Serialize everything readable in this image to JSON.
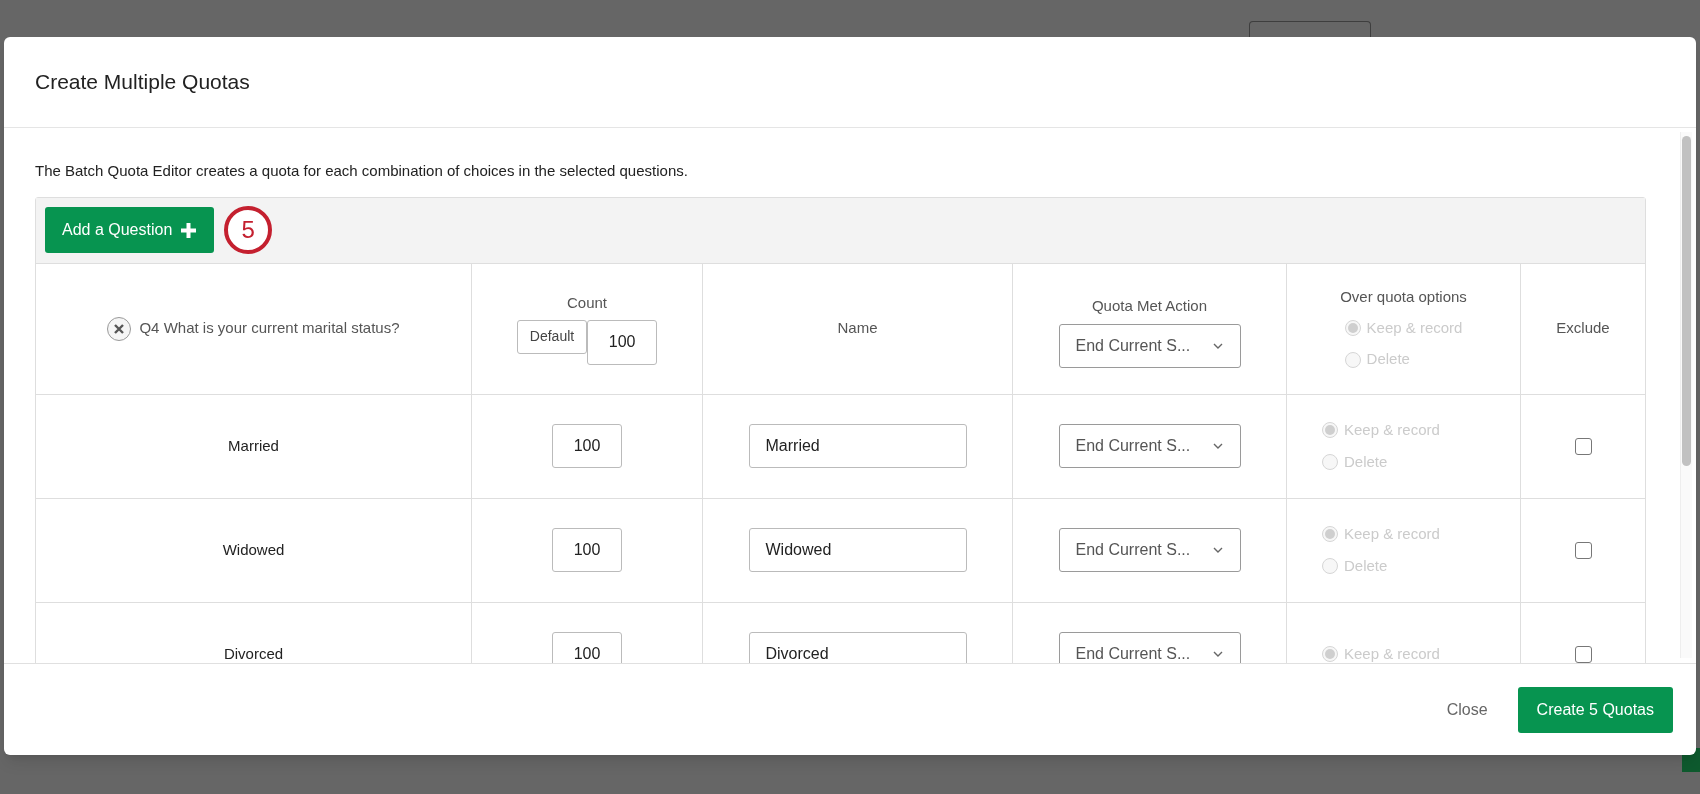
{
  "window": {
    "title": "Create Multiple Quotas"
  },
  "description": "The Batch Quota Editor creates a quota for each combination of choices in the selected questions.",
  "add_question_button": "Add a Question",
  "callout": "5",
  "table": {
    "question": "Q4 What is your current marital status?",
    "count_header": {
      "label": "Count",
      "default_button": "Default",
      "value": "100"
    },
    "name_header": "Name",
    "action_header": {
      "label": "Quota Met Action",
      "value": "End Current S..."
    },
    "over_quota_header": {
      "label": "Over quota options",
      "disabled": true,
      "options": [
        {
          "label": "Keep & record",
          "selected": true
        },
        {
          "label": "Delete",
          "selected": false
        }
      ]
    },
    "exclude_header": "Exclude",
    "rows": [
      {
        "choice": "Married",
        "count": "100",
        "name": "Married",
        "action": "End Current S...",
        "over_quota": {
          "disabled": true,
          "options": [
            {
              "label": "Keep & record",
              "selected": true
            },
            {
              "label": "Delete",
              "selected": false
            }
          ]
        },
        "exclude_checked": false
      },
      {
        "choice": "Widowed",
        "count": "100",
        "name": "Widowed",
        "action": "End Current S...",
        "over_quota": {
          "disabled": true,
          "options": [
            {
              "label": "Keep & record",
              "selected": true
            },
            {
              "label": "Delete",
              "selected": false
            }
          ]
        },
        "exclude_checked": false
      },
      {
        "choice": "Divorced",
        "count": "100",
        "name": "Divorced",
        "action": "End Current S...",
        "over_quota": {
          "disabled": true,
          "options": [
            {
              "label": "Keep & record",
              "selected": true
            }
          ]
        },
        "exclude_checked": false
      }
    ]
  },
  "footer": {
    "close": "Close",
    "create": "Create 5 Quotas"
  }
}
